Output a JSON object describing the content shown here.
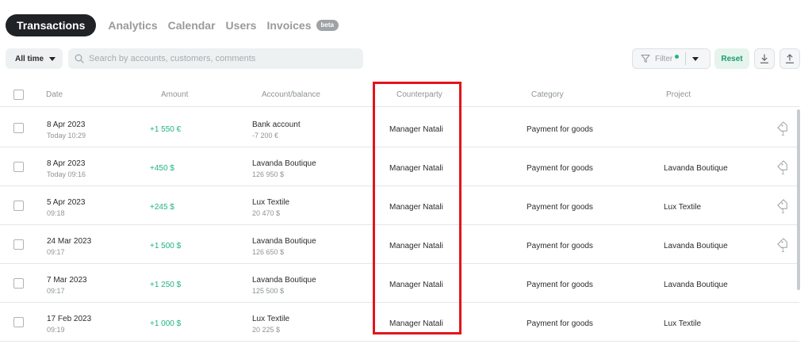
{
  "tabs": [
    {
      "label": "Transactions",
      "active": true
    },
    {
      "label": "Analytics"
    },
    {
      "label": "Calendar"
    },
    {
      "label": "Users"
    },
    {
      "label": "Invoices",
      "badge": "beta"
    }
  ],
  "toolbar": {
    "period_label": "All time",
    "search_placeholder": "Search by accounts, customers, comments",
    "filter_label": "Filter",
    "reset_label": "Reset",
    "accent_color": "#1fb381"
  },
  "table": {
    "columns": [
      "Date",
      "Amount",
      "Account/balance",
      "Counterparty",
      "Category",
      "Project"
    ],
    "rows": [
      {
        "date": "8 Apr 2023",
        "time": "Today 10:29",
        "amount": "+1 550 €",
        "account": "Bank account",
        "balance": "-7 200 €",
        "counterparty": "Manager Natali",
        "category": "Payment for goods",
        "project": "",
        "tags": "1"
      },
      {
        "date": "8 Apr 2023",
        "time": "Today 09:16",
        "amount": "+450  $",
        "account": "Lavanda Boutique",
        "balance": "126 950  $",
        "counterparty": "Manager Natali",
        "category": "Payment for goods",
        "project": "Lavanda Boutique",
        "tags": "1"
      },
      {
        "date": "5 Apr 2023",
        "time": "09:18",
        "amount": "+245  $",
        "account": "Lux Textile",
        "balance": "20 470  $",
        "counterparty": "Manager Natali",
        "category": "Payment for goods",
        "project": "Lux Textile",
        "tags": "1"
      },
      {
        "date": "24 Mar 2023",
        "time": "09:17",
        "amount": "+1 500  $",
        "account": "Lavanda Boutique",
        "balance": "126 650  $",
        "counterparty": "Manager Natali",
        "category": "Payment for goods",
        "project": "Lavanda Boutique",
        "tags": "1"
      },
      {
        "date": "7 Mar 2023",
        "time": "09:17",
        "amount": "+1 250  $",
        "account": "Lavanda Boutique",
        "balance": "125 500  $",
        "counterparty": "Manager Natali",
        "category": "Payment for goods",
        "project": "Lavanda Boutique",
        "tags": ""
      },
      {
        "date": "17 Feb 2023",
        "time": "09:19",
        "amount": "+1 000  $",
        "account": "Lux Textile",
        "balance": "20 225  $",
        "counterparty": "Manager Natali",
        "category": "Payment for goods",
        "project": "Lux Textile",
        "tags": ""
      }
    ]
  },
  "icons": {
    "search": "search-icon",
    "filter": "filter-icon",
    "download": "download-icon",
    "upload": "upload-icon",
    "tag": "tag-icon"
  },
  "highlight": {
    "color": "#e2151b",
    "column": "Counterparty"
  }
}
